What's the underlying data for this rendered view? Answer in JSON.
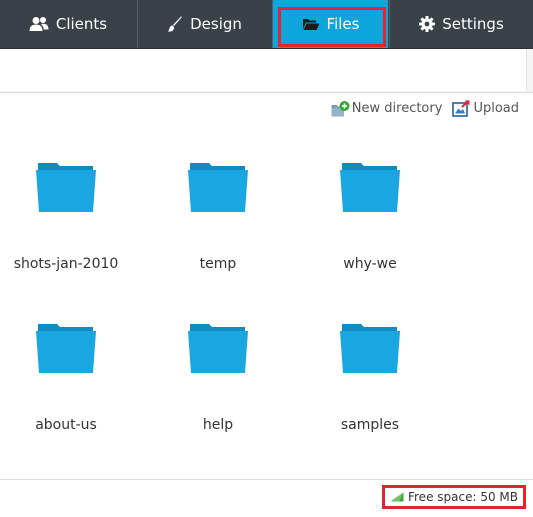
{
  "nav": {
    "tabs": [
      {
        "id": "clients",
        "label": "Clients",
        "icon": "users-icon"
      },
      {
        "id": "design",
        "label": "Design",
        "icon": "brush-icon"
      },
      {
        "id": "files",
        "label": "Files",
        "icon": "folder-open-icon",
        "active": true
      },
      {
        "id": "settings",
        "label": "Settings",
        "icon": "gear-icon"
      }
    ]
  },
  "actions": {
    "new_directory": "New directory",
    "upload": "Upload"
  },
  "folders": [
    {
      "name": "shots-jan-2010"
    },
    {
      "name": "temp"
    },
    {
      "name": "why-we"
    },
    {
      "name": "about-us"
    },
    {
      "name": "help"
    },
    {
      "name": "samples"
    }
  ],
  "status": {
    "free_space": "Free space: 50 MB"
  },
  "colors": {
    "nav_bg": "#3b4148",
    "active_tab": "#0ea5dd",
    "folder": "#1aa6e0",
    "highlight": "#e5232b"
  }
}
